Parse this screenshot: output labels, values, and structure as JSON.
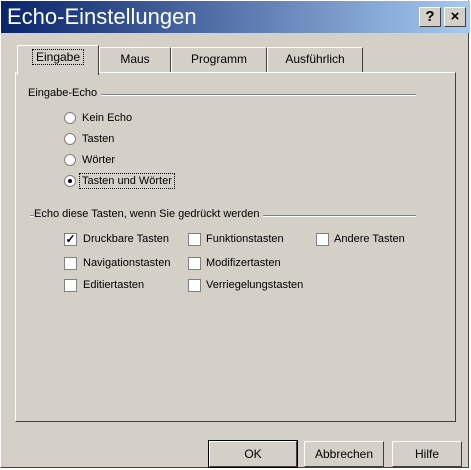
{
  "window": {
    "title": "Echo-Einstellungen",
    "help_button": "?",
    "close_button": "×"
  },
  "tabs": [
    {
      "label": "Eingabe"
    },
    {
      "label": "Maus"
    },
    {
      "label": "Programm"
    },
    {
      "label": "Ausführlich"
    }
  ],
  "echo_group": {
    "title": "Eingabe-Echo",
    "options": [
      {
        "label": "Kein Echo",
        "checked": false
      },
      {
        "label": "Tasten",
        "checked": false
      },
      {
        "label": "Wörter",
        "checked": false
      },
      {
        "label": "Tasten und Wörter",
        "checked": true
      }
    ]
  },
  "keys_group": {
    "title": "Echo diese Tasten, wenn Sie gedrückt werden",
    "items": [
      {
        "label": "Druckbare Tasten",
        "checked": true
      },
      {
        "label": "Funktionstasten",
        "checked": false
      },
      {
        "label": "Andere Tasten",
        "checked": false
      },
      {
        "label": "Navigationstasten",
        "checked": false
      },
      {
        "label": "Modifizertasten",
        "checked": false
      },
      {
        "label": "Editiertasten",
        "checked": false
      },
      {
        "label": "Verriegelungstasten",
        "checked": false
      }
    ]
  },
  "buttons": {
    "ok": "OK",
    "cancel": "Abbrechen",
    "help": "Hilfe"
  }
}
